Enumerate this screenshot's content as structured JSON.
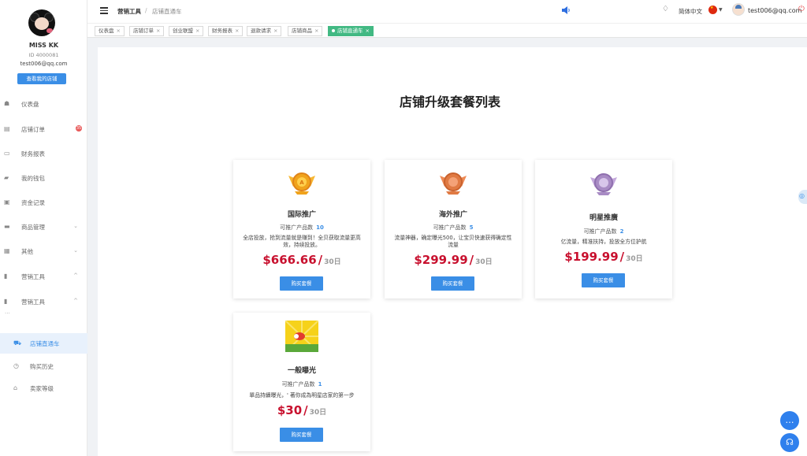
{
  "user": {
    "name": "MISS KK",
    "id": "ID 4000081",
    "email": "test006@qq.com",
    "shop_button": "查看我的店铺"
  },
  "sidebar": {
    "items": [
      {
        "label": "仪表盘",
        "icon": "dashboard-icon"
      },
      {
        "label": "店铺订单",
        "icon": "orders-icon",
        "badge": "35"
      },
      {
        "label": "财务报表",
        "icon": "report-icon"
      },
      {
        "label": "我的钱包",
        "icon": "wallet-icon"
      },
      {
        "label": "资金记录",
        "icon": "funds-icon"
      },
      {
        "label": "商品管理",
        "icon": "goods-icon",
        "chevron": "⌄"
      },
      {
        "label": "其他",
        "icon": "grid-icon",
        "chevron": "⌄"
      },
      {
        "label": "营销工具",
        "icon": "chart-icon",
        "chevron": "^"
      },
      {
        "label": "营销工具",
        "icon": "chart-icon",
        "chevron": "^"
      }
    ],
    "more": "...",
    "sub_items": [
      {
        "label": "店铺直通车",
        "icon": "truck-icon",
        "active": true
      },
      {
        "label": "购买历史",
        "icon": "clock-icon",
        "active": false
      },
      {
        "label": "卖家等级",
        "icon": "level-icon",
        "active": false
      }
    ]
  },
  "header": {
    "breadcrumb": [
      "营销工具",
      "店铺直通车"
    ],
    "separator": "/",
    "language": "简体中文",
    "email": "test006@qq.com"
  },
  "tabs": [
    {
      "label": "仪表盘",
      "close": "×"
    },
    {
      "label": "店铺订单",
      "close": "×"
    },
    {
      "label": "创业联盟",
      "close": "×"
    },
    {
      "label": "财务报表",
      "close": "×"
    },
    {
      "label": "退款请求",
      "close": "×"
    },
    {
      "label": "店铺商品",
      "close": "×"
    },
    {
      "label": "店铺直通车",
      "close": "×",
      "active": true
    }
  ],
  "page": {
    "title": "店铺升级套餐列表",
    "count_label": "可推广产品数",
    "buy_label": "购买套餐",
    "period_unit": "30日",
    "packages": [
      {
        "title": "国际推广",
        "count": "10",
        "desc": "全店投放，抢到流量就是赚到！全贝获取流量更高效，持续投放。",
        "price": "$666.66",
        "medal": "gold-medal-icon",
        "color": "#f0a31c"
      },
      {
        "title": "海外推广",
        "count": "5",
        "desc": "流量神器，确定曝光500，让宝贝快速获得确定性流量",
        "price": "$299.99",
        "medal": "bronze-medal-icon",
        "color": "#e07a43"
      },
      {
        "title": "明星推廣",
        "count": "2",
        "desc": "亿流量，精准扶持，投放全方位护航",
        "price": "$199.99",
        "medal": "silver-medal-icon",
        "color": "#a88bc4"
      },
      {
        "title": "一般曝光",
        "count": "1",
        "desc": "單品持續曝光，' 著你成為明星店家的第一步",
        "price": "$30",
        "medal": "sunburst-image",
        "color": "#f6d21a"
      }
    ]
  }
}
